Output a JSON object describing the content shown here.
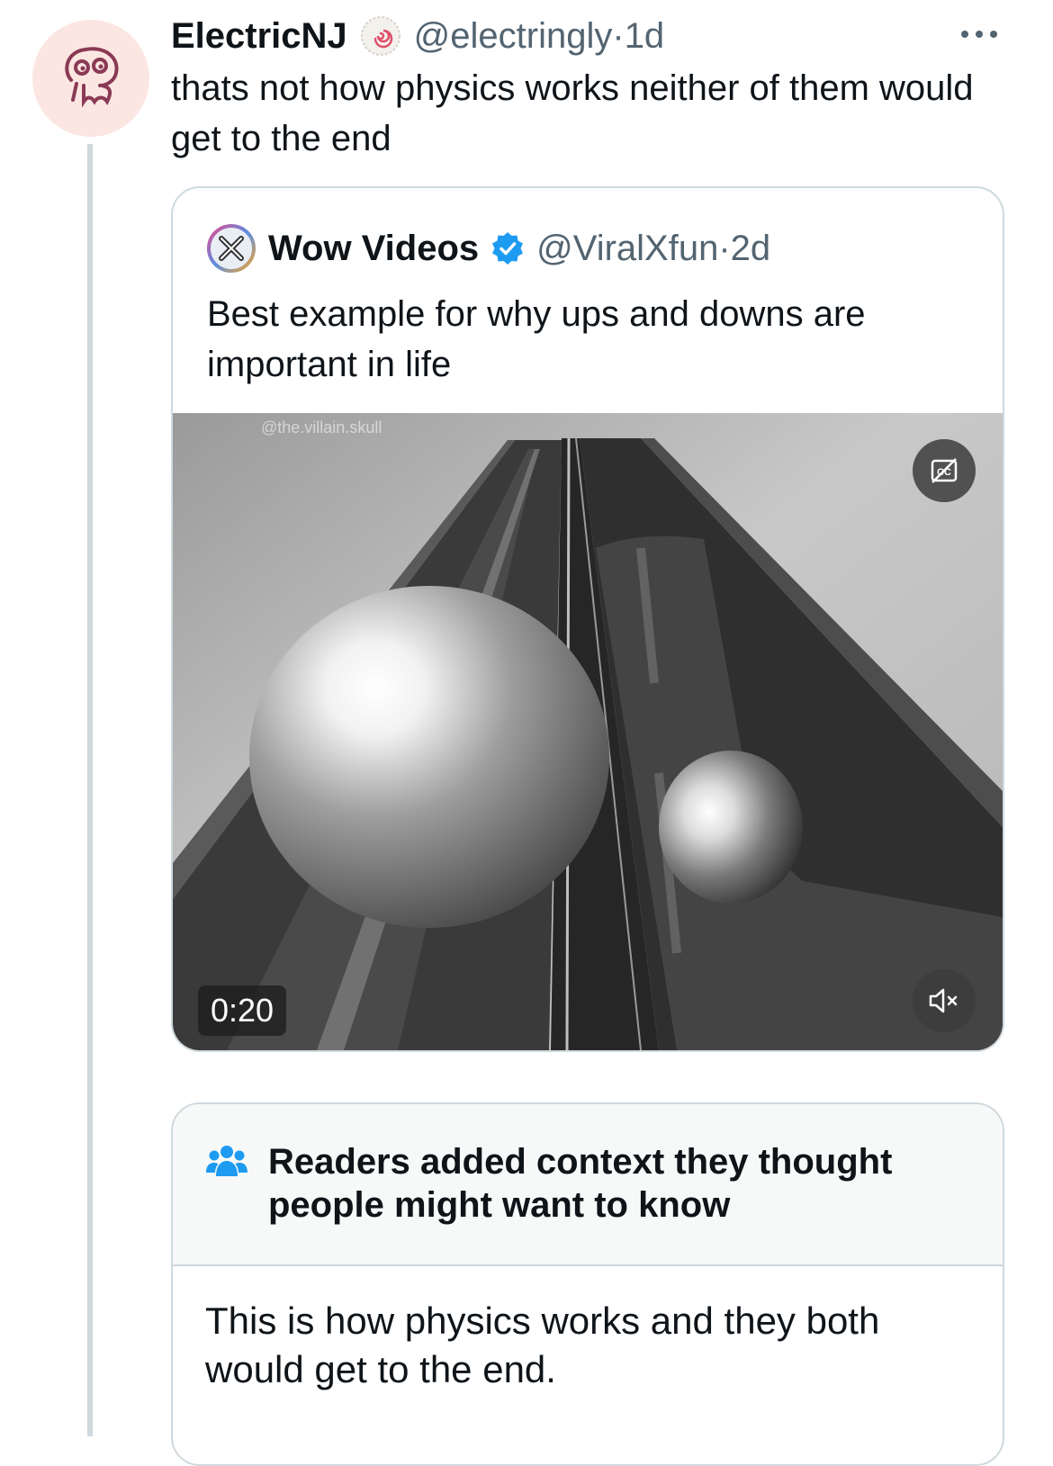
{
  "reply": {
    "author_name": "ElectricNJ",
    "handle": "@electringly",
    "separator": " · ",
    "time": "1d",
    "text": "thats not how physics works neither of them would get to the end",
    "avatar_icon": "cartoon-face-avatar-icon",
    "badge_icon": "spiral-badge-icon"
  },
  "quote": {
    "author_name": "Wow Videos",
    "handle": "@ViralXfun",
    "separator": " · ",
    "time": "2d",
    "text": "Best example for why ups and downs are important in life",
    "verified_color": "#1d9bf0",
    "video": {
      "watermark": "@the.villain.skull",
      "duration": "0:20"
    }
  },
  "community_note": {
    "title": "Readers added context they thought people might want to know",
    "body": "This is how physics works and they both would get to the end.",
    "icon_color": "#1d9bf0"
  },
  "colors": {
    "text": "#0f1419",
    "secondary": "#536471",
    "border": "#cfd9de",
    "accent": "#1d9bf0"
  }
}
